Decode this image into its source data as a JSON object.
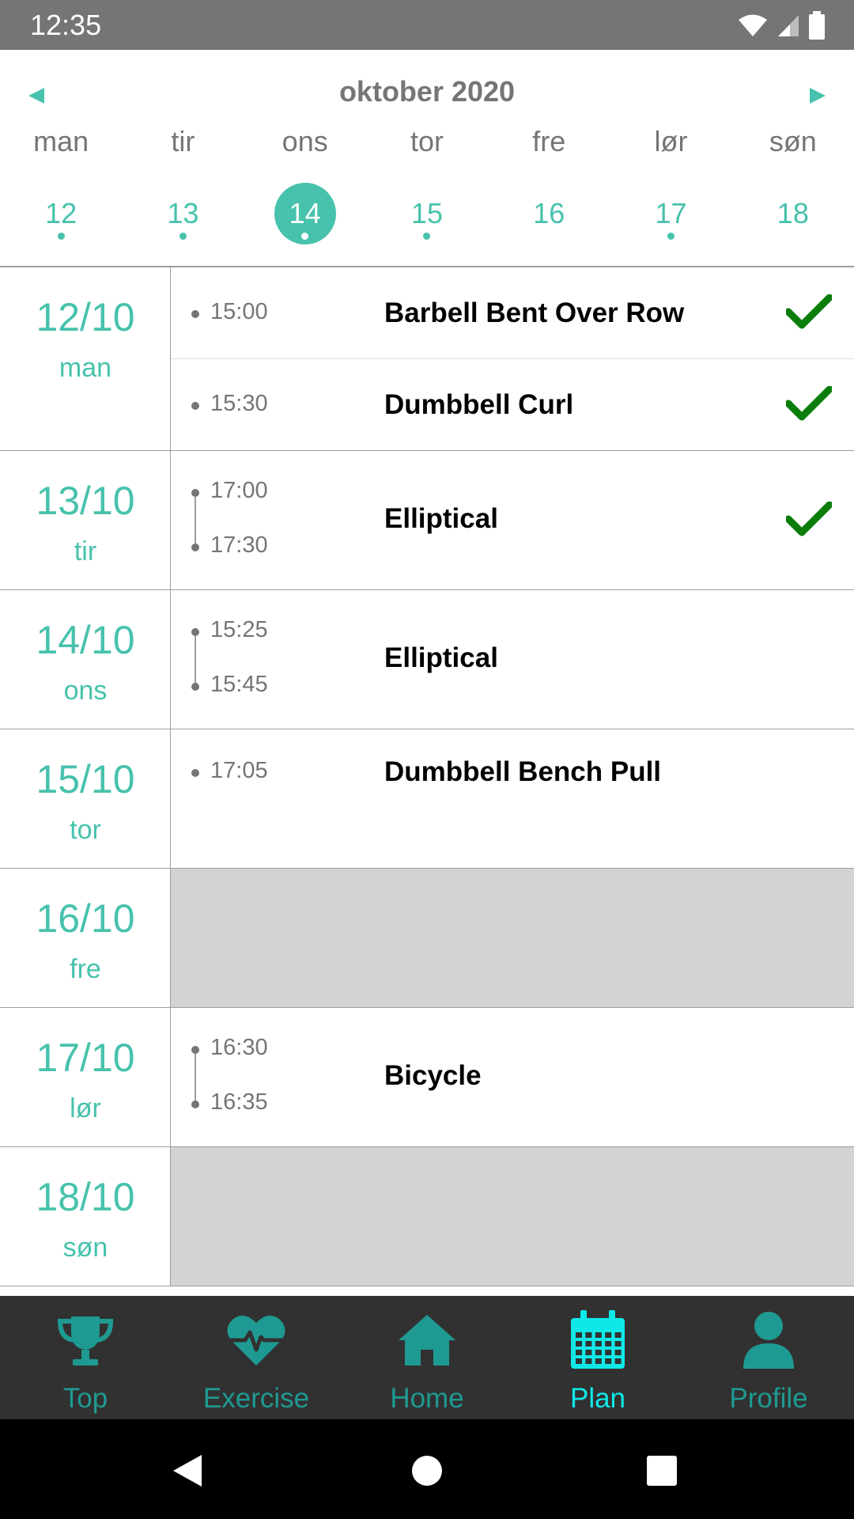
{
  "status_bar": {
    "time": "12:35"
  },
  "calendar": {
    "month_title": "oktober 2020",
    "weekdays": [
      "man",
      "tir",
      "ons",
      "tor",
      "fre",
      "lør",
      "søn"
    ],
    "dates": [
      {
        "num": "12",
        "has_dot": true,
        "selected": false
      },
      {
        "num": "13",
        "has_dot": true,
        "selected": false
      },
      {
        "num": "14",
        "has_dot": true,
        "selected": true
      },
      {
        "num": "15",
        "has_dot": true,
        "selected": false
      },
      {
        "num": "16",
        "has_dot": false,
        "selected": false
      },
      {
        "num": "17",
        "has_dot": true,
        "selected": false
      },
      {
        "num": "18",
        "has_dot": false,
        "selected": false
      }
    ]
  },
  "agenda": [
    {
      "date": "12/10",
      "day": "man",
      "entries": [
        {
          "start": "15:00",
          "end": "",
          "name": "Barbell Bent Over Row",
          "done": true
        },
        {
          "start": "15:30",
          "end": "",
          "name": "Dumbbell Curl",
          "done": true
        }
      ]
    },
    {
      "date": "13/10",
      "day": "tir",
      "entries": [
        {
          "start": "17:00",
          "end": "17:30",
          "name": "Elliptical",
          "done": true
        }
      ]
    },
    {
      "date": "14/10",
      "day": "ons",
      "entries": [
        {
          "start": "15:25",
          "end": "15:45",
          "name": "Elliptical",
          "done": false
        }
      ]
    },
    {
      "date": "15/10",
      "day": "tor",
      "entries": [
        {
          "start": "17:05",
          "end": "",
          "name": "Dumbbell Bench Pull",
          "done": false
        }
      ]
    },
    {
      "date": "16/10",
      "day": "fre",
      "entries": []
    },
    {
      "date": "17/10",
      "day": "lør",
      "entries": [
        {
          "start": "16:30",
          "end": "16:35",
          "name": "Bicycle",
          "done": false
        }
      ]
    },
    {
      "date": "18/10",
      "day": "søn",
      "entries": []
    }
  ],
  "bottom_nav": [
    {
      "label": "Top",
      "icon": "trophy-icon",
      "active": false
    },
    {
      "label": "Exercise",
      "icon": "heartbeat-icon",
      "active": false
    },
    {
      "label": "Home",
      "icon": "home-icon",
      "active": false
    },
    {
      "label": "Plan",
      "icon": "calendar-icon",
      "active": true
    },
    {
      "label": "Profile",
      "icon": "user-icon",
      "active": false
    }
  ],
  "colors": {
    "accent": "#47c2ac",
    "check": "#0a7d0a",
    "nav_bg": "#313131",
    "nav_inactive": "#1e9a92",
    "nav_active": "#10e8e8",
    "empty_day": "#d3d3d3"
  }
}
